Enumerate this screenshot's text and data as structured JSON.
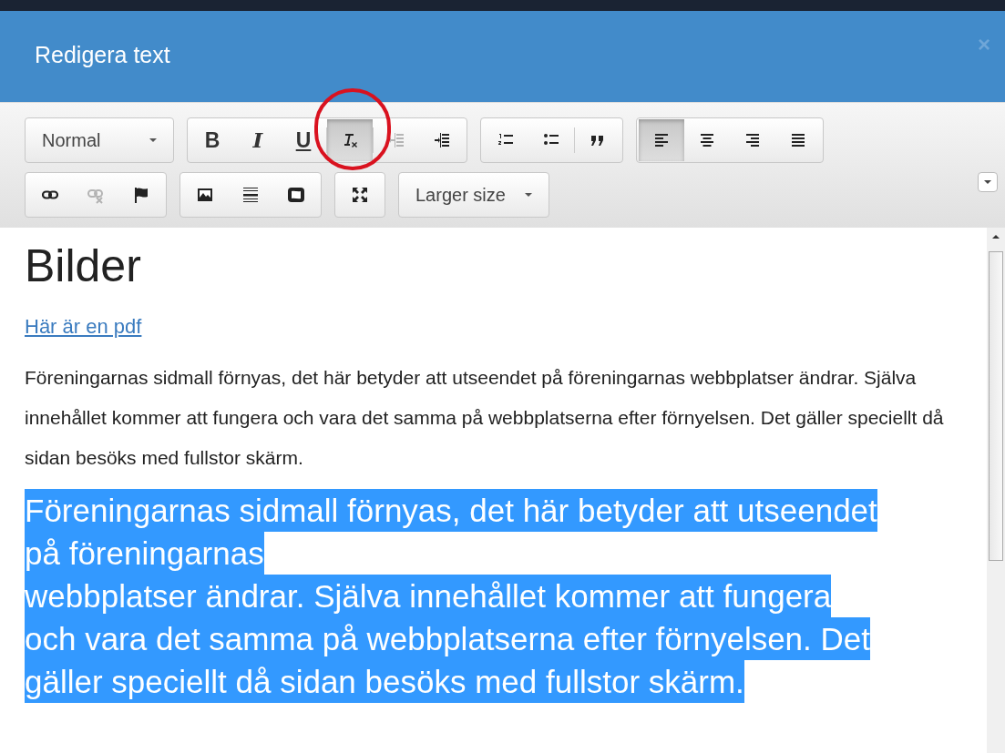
{
  "dialog": {
    "title": "Redigera text",
    "close": "×"
  },
  "toolbar": {
    "rows": [
      [
        {
          "kind": "dropdown",
          "label": "Normal"
        },
        {
          "kind": "buttons",
          "buttons": [
            {
              "label": "B",
              "selected": false,
              "disabled": false
            },
            {
              "label": "I",
              "selected": false,
              "disabled": false
            },
            {
              "label": "U",
              "selected": false,
              "disabled": false
            },
            {
              "selected": true,
              "disabled": false
            },
            {
              "selected": false,
              "disabled": true
            },
            {
              "selected": false,
              "disabled": false
            }
          ]
        },
        {
          "kind": "buttons",
          "buttons": [
            {
              "selected": false,
              "disabled": false
            },
            {
              "selected": false,
              "disabled": false
            },
            {
              "selected": false,
              "disabled": false
            }
          ]
        },
        {
          "kind": "buttons",
          "buttons": [
            {
              "selected": true,
              "disabled": false
            },
            {
              "selected": false,
              "disabled": false
            },
            {
              "selected": false,
              "disabled": false
            },
            {
              "selected": false,
              "disabled": false
            }
          ]
        }
      ],
      [
        {
          "kind": "buttons",
          "buttons": [
            {
              "selected": false,
              "disabled": false
            },
            {
              "selected": false,
              "disabled": true
            },
            {
              "selected": false,
              "disabled": false
            }
          ]
        },
        {
          "kind": "buttons",
          "buttons": [
            {
              "selected": false,
              "disabled": false
            },
            {
              "selected": false,
              "disabled": false
            },
            {
              "selected": false,
              "disabled": false
            }
          ]
        },
        {
          "kind": "buttons",
          "buttons": [
            {
              "selected": false,
              "disabled": false
            }
          ]
        },
        {
          "kind": "dropdown",
          "label": "Larger size"
        }
      ]
    ]
  },
  "content": {
    "heading": "Bilder",
    "link": "Här är en pdf",
    "paragraph": "Föreningarnas sidmall förnyas, det här betyder att utseendet på föreningarnas webbplatser ändrar. Själva innehållet kommer att fungera och vara det samma på webbplatserna efter förnyelsen. Det gäller speciellt då sidan besöks med fullstor skärm.",
    "large_paragraph": {
      "selected": true,
      "lines": [
        "Föreningarnas sidmall förnyas, det här betyder att utseendet",
        "på föreningarnas",
        "webbplatser ändrar. Själva innehållet kommer att fungera",
        "och vara det samma på webbplatserna efter förnyelsen. Det",
        "gäller speciellt då sidan besöks med fullstor skärm."
      ]
    }
  }
}
